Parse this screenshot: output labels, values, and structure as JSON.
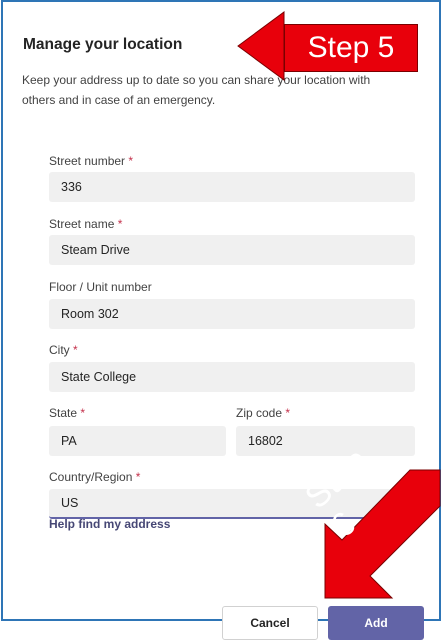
{
  "dialog": {
    "title": "Manage your location",
    "description": "Keep your address up to date so you can share your location with others and in case of an emergency."
  },
  "form": {
    "street_number": {
      "label": "Street number",
      "required": "*",
      "value": "336"
    },
    "street_name": {
      "label": "Street name",
      "required": "*",
      "value": "Steam Drive"
    },
    "floor_unit": {
      "label": "Floor / Unit number",
      "value": "Room 302"
    },
    "city": {
      "label": "City",
      "required": "*",
      "value": "State College"
    },
    "state": {
      "label": "State",
      "required": "*",
      "value": "PA"
    },
    "zip": {
      "label": "Zip code",
      "required": "*",
      "value": "16802"
    },
    "country": {
      "label": "Country/Region",
      "required": "*",
      "value": "US"
    }
  },
  "help_link": "Help find my address",
  "buttons": {
    "cancel": "Cancel",
    "add": "Add"
  },
  "annotations": {
    "step5": "Step 5",
    "step6": "Step 6"
  },
  "colors": {
    "accent": "#6264a7",
    "callout": "#e8000b",
    "required": "#c4314b",
    "frame": "#2e75b6"
  }
}
